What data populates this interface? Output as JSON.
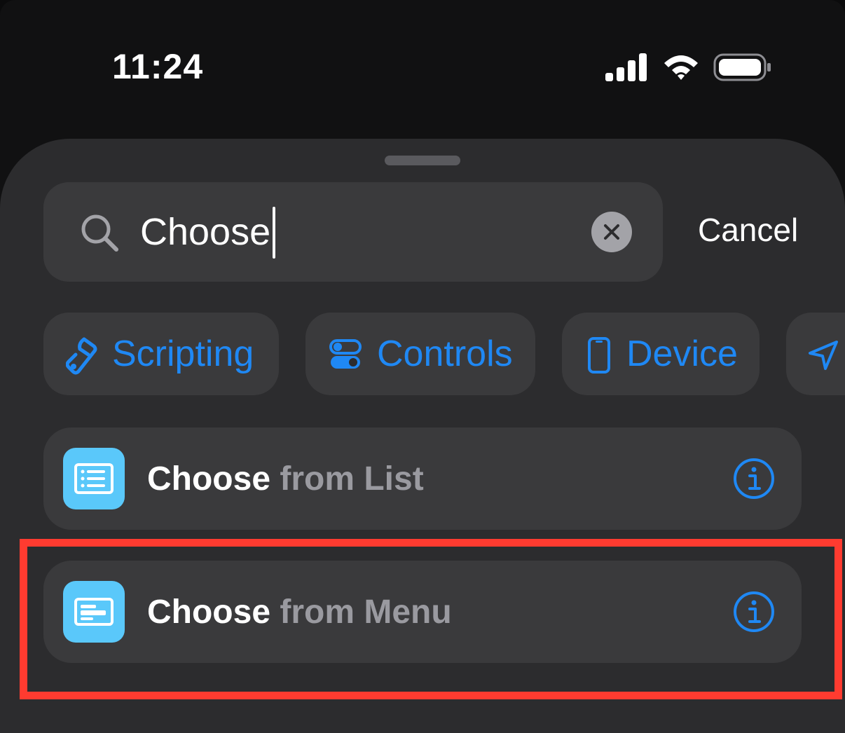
{
  "status_bar": {
    "time": "11:24",
    "icons": [
      "cellular-signal-icon",
      "wifi-icon",
      "battery-icon"
    ]
  },
  "search": {
    "value": "Choose",
    "cancel_label": "Cancel"
  },
  "categories": [
    {
      "label": "Scripting",
      "icon": "scripting-icon"
    },
    {
      "label": "Controls",
      "icon": "controls-toggle-icon"
    },
    {
      "label": "Device",
      "icon": "device-phone-icon"
    },
    {
      "label": "",
      "icon": "location-arrow-icon"
    }
  ],
  "results": [
    {
      "match": "Choose",
      "rest": " from List",
      "icon": "list-icon",
      "selected": false
    },
    {
      "match": "Choose",
      "rest": " from Menu",
      "icon": "menu-icon",
      "selected": true
    }
  ],
  "colors": {
    "accent": "#1f88f4",
    "sheet": "#2c2c2e",
    "row": "#3a3a3c",
    "app_icon": "#5ac8fa",
    "highlight": "#ff3b30"
  }
}
